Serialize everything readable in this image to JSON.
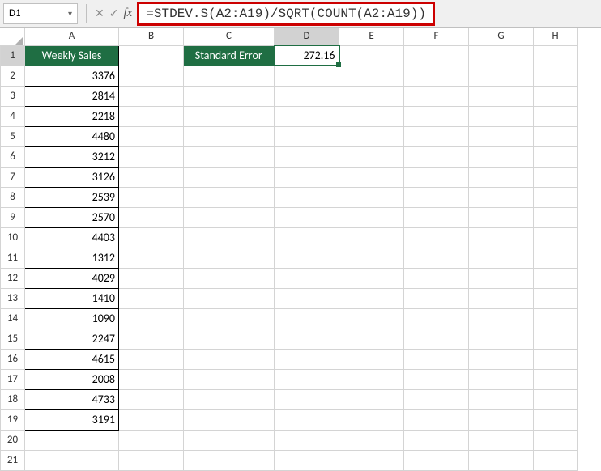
{
  "name_box": "D1",
  "formula": "=STDEV.S(A2:A19)/SQRT(COUNT(A2:A19))",
  "columns": [
    "A",
    "B",
    "C",
    "D",
    "E",
    "F",
    "G",
    "H"
  ],
  "rows": [
    "1",
    "2",
    "3",
    "4",
    "5",
    "6",
    "7",
    "8",
    "9",
    "10",
    "11",
    "12",
    "13",
    "14",
    "15",
    "16",
    "17",
    "18",
    "19",
    "20",
    "21"
  ],
  "selected_col": "D",
  "selected_row": "1",
  "table": {
    "headerA": "Weekly Sales",
    "labelC1": "Standard Error",
    "valueD1": "272.16",
    "salesA": [
      "3376",
      "2814",
      "2218",
      "4480",
      "3212",
      "3126",
      "2539",
      "2570",
      "4403",
      "1312",
      "4029",
      "1410",
      "1090",
      "2247",
      "4615",
      "2008",
      "4733",
      "3191"
    ]
  },
  "chart_data": {
    "type": "table",
    "title": "Weekly Sales",
    "columns": [
      "Weekly Sales"
    ],
    "values": [
      3376,
      2814,
      2218,
      4480,
      3212,
      3126,
      2539,
      2570,
      4403,
      1312,
      4029,
      1410,
      1090,
      2247,
      4615,
      2008,
      4733,
      3191
    ],
    "computed": {
      "label": "Standard Error",
      "value": 272.16
    }
  }
}
